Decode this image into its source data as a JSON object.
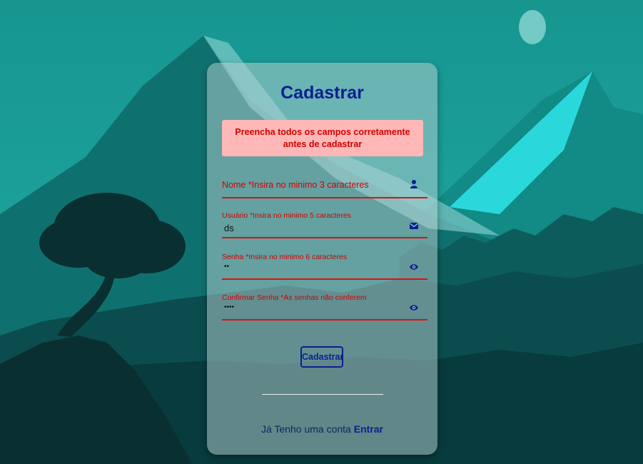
{
  "form": {
    "title": "Cadastrar",
    "alert": "Preencha todos os campos corretamente antes de cadastrar",
    "fields": [
      {
        "label": "Nome *Insira no minimo 3 caracteres",
        "value": "",
        "icon": "user-icon"
      },
      {
        "label": "Usuário *Insira no minimo 5 caracteres",
        "value": "ds",
        "icon": "envelope-icon"
      },
      {
        "label": "Senha *Insira no minimo 6 caracteres",
        "value": "••",
        "icon": "eye-icon"
      },
      {
        "label": "Confirmar Senha *As senhas não conferem",
        "value": "••••",
        "icon": "eye-icon"
      }
    ],
    "submit_label": "Cadastrar",
    "footer_text": "Já Tenho uma conta",
    "footer_link": "Entrar"
  },
  "colors": {
    "title": "#0a1f8f",
    "error": "#d00000",
    "alert_bg": "#ffb7b7"
  }
}
